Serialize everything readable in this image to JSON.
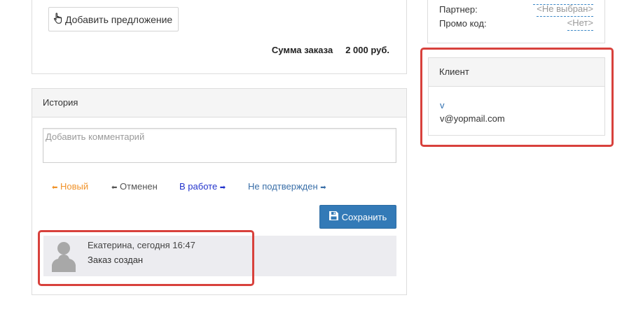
{
  "order": {
    "add_offer_label": "Добавить предложение",
    "total_label": "Сумма заказа",
    "total_value": "2 000 руб."
  },
  "history": {
    "title": "История",
    "comment_placeholder": "Добавить комментарий",
    "statuses": [
      {
        "label": "Новый",
        "arrow": "left",
        "color": "#f0932b"
      },
      {
        "label": "Отменен",
        "arrow": "left",
        "color": "#555555"
      },
      {
        "label": "В работе",
        "arrow": "right",
        "color": "#2233cc"
      },
      {
        "label": "Не подтвержден",
        "arrow": "right",
        "color": "#3a6fa8"
      }
    ],
    "save_label": "Сохранить",
    "entry": {
      "author": "Екатерина, сегодня 16:47",
      "text": "Заказ создан"
    }
  },
  "info": {
    "partner_label": "Партнер:",
    "partner_value": "<Не выбран>",
    "promo_label": "Промо код:",
    "promo_value": "<Нет>"
  },
  "client": {
    "title": "Клиент",
    "name": "v",
    "email": "v@yopmail.com"
  },
  "colors": {
    "primary": "#337ab7",
    "highlight": "#d8413c",
    "entry_bg": "#ececf0"
  }
}
